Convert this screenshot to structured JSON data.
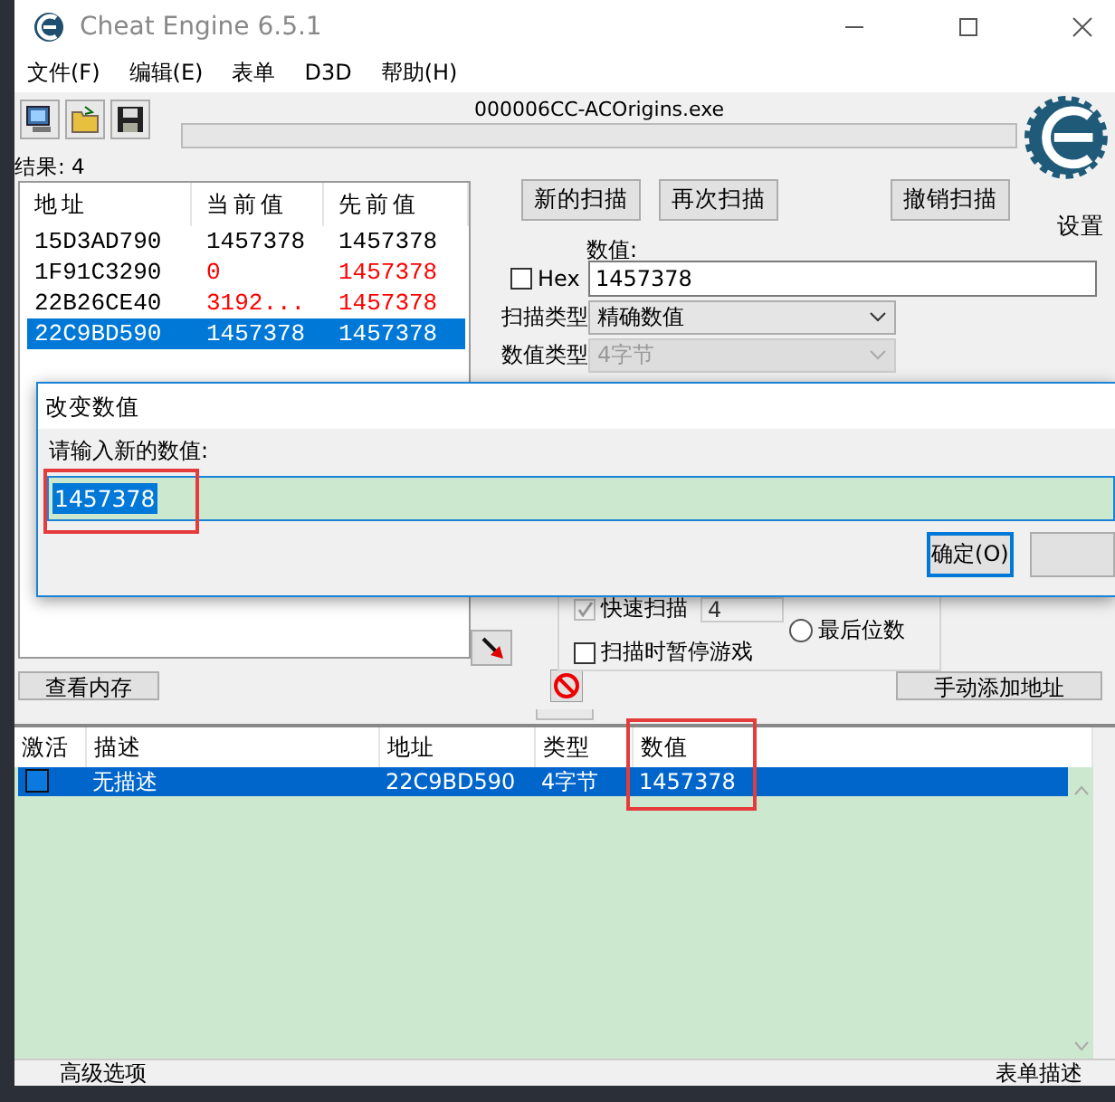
{
  "window": {
    "title": "Cheat Engine 6.5.1"
  },
  "menu": [
    "文件(F)",
    "编辑(E)",
    "表单",
    "D3D",
    "帮助(H)"
  ],
  "process": "000006CC-ACOrigins.exe",
  "scan_progress": {
    "level": 0
  },
  "settings_label": "设置",
  "results": {
    "label": "结果: 4",
    "columns": [
      "地址",
      "当前值",
      "先前值"
    ],
    "rows": [
      {
        "address": "15D3AD790",
        "current": "1457378",
        "previous": "1457378",
        "current_changed": false,
        "previous_changed": false,
        "selected": false
      },
      {
        "address": "1F91C3290",
        "current": "0",
        "previous": "1457378",
        "current_changed": true,
        "previous_changed": true,
        "selected": false
      },
      {
        "address": "22B26CE40",
        "current": "3192...",
        "previous": "1457378",
        "current_changed": true,
        "previous_changed": true,
        "selected": false
      },
      {
        "address": "22C9BD590",
        "current": "1457378",
        "previous": "1457378",
        "current_changed": false,
        "previous_changed": false,
        "selected": true
      }
    ]
  },
  "scan": {
    "buttons": [
      "新的扫描",
      "再次扫描",
      "撤销扫描"
    ],
    "value_label": "数值:",
    "hex": {
      "label": "Hex",
      "checked": false
    },
    "value": "1457378",
    "scan_type_label": "扫描类型",
    "scan_type": "精确数值",
    "value_type_label": "数值类型",
    "value_type": "4字节",
    "value_type_disabled": true,
    "fast_scan": {
      "label": "快速扫描",
      "checked": true,
      "disabled": true,
      "value": "4"
    },
    "last_digits": {
      "label": "最后位数",
      "selected": false
    },
    "pause": {
      "label": "扫描时暂停游戏",
      "checked": false
    }
  },
  "view_memory": "查看内存",
  "add_address": "手动添加地址",
  "address_list": {
    "columns": [
      "激活",
      "描述",
      "地址",
      "类型",
      "数值"
    ],
    "rows": [
      {
        "active": false,
        "description": "无描述",
        "address": "22C9BD590",
        "type": "4字节",
        "value": "1457378",
        "selected": true
      }
    ]
  },
  "status": {
    "advanced": "高级选项",
    "table_notes": "表单描述"
  },
  "dialog": {
    "title": "改变数值",
    "prompt": "请输入新的数值:",
    "value": "1457378",
    "text_selected": true,
    "buttons": [
      "确定(O)"
    ]
  }
}
